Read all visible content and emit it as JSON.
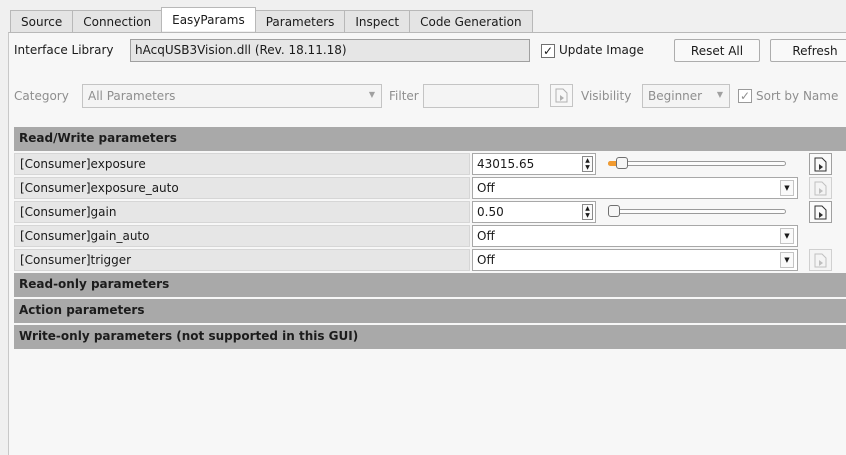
{
  "tabs": [
    {
      "label": "Source"
    },
    {
      "label": "Connection"
    },
    {
      "label": "EasyParams"
    },
    {
      "label": "Parameters"
    },
    {
      "label": "Inspect"
    },
    {
      "label": "Code Generation"
    }
  ],
  "active_tab": "EasyParams",
  "interface": {
    "label": "Interface Library",
    "value": "hAcqUSB3Vision.dll (Rev. 18.11.18)",
    "update_image_label": "Update Image",
    "update_image_checked": true,
    "reset_all_label": "Reset All",
    "refresh_label": "Refresh"
  },
  "filters": {
    "category_label": "Category",
    "category_value": "All Parameters",
    "filter_label": "Filter",
    "filter_value": "",
    "visibility_label": "Visibility",
    "visibility_value": "Beginner",
    "sort_label": "Sort by Name",
    "sort_checked": true
  },
  "sections": {
    "read_write": "Read/Write parameters",
    "read_only": "Read-only parameters",
    "action": "Action parameters",
    "write_only": "Write-only parameters (not supported in this GUI)"
  },
  "params": [
    {
      "name": "[Consumer]exposure",
      "value": "43015.65",
      "kind": "slider",
      "level": 0.05
    },
    {
      "name": "[Consumer]exposure_auto",
      "value": "Off",
      "kind": "dropdown"
    },
    {
      "name": "[Consumer]gain",
      "value": "0.50",
      "kind": "slider",
      "level": 0.0
    },
    {
      "name": "[Consumer]gain_auto",
      "value": "Off",
      "kind": "dropdown"
    },
    {
      "name": "[Consumer]trigger",
      "value": "Off",
      "kind": "dropdown"
    }
  ],
  "colors": {
    "section_header": "#a9a9a9",
    "slider_accent": "#f29b30"
  }
}
